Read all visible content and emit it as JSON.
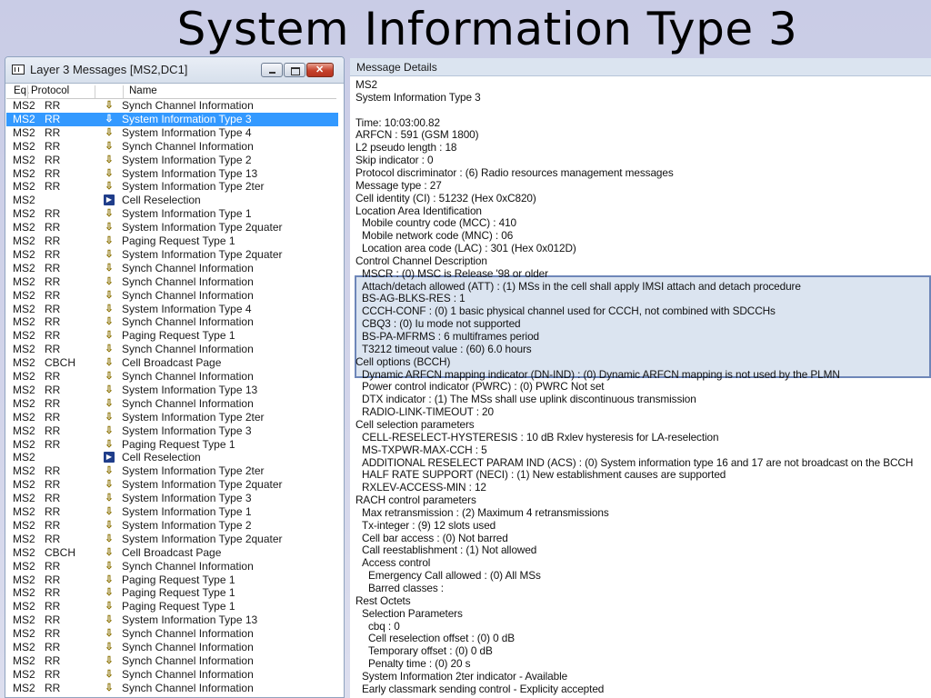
{
  "slide": {
    "title": "System Information Type 3"
  },
  "left_window": {
    "title": "Layer 3 Messages  [MS2,DC1]",
    "columns": {
      "eq": "Eq.",
      "protocol": "Protocol",
      "name": "Name"
    },
    "selected_index": 1,
    "rows": [
      {
        "eq": "MS2",
        "protocol": "RR",
        "icon": "down-arrow-icon",
        "name": "Synch Channel Information"
      },
      {
        "eq": "MS2",
        "protocol": "RR",
        "icon": "down-arrow-icon",
        "name": "System Information Type 3"
      },
      {
        "eq": "MS2",
        "protocol": "RR",
        "icon": "down-arrow-icon",
        "name": "System Information Type 4"
      },
      {
        "eq": "MS2",
        "protocol": "RR",
        "icon": "down-arrow-icon",
        "name": "Synch Channel Information"
      },
      {
        "eq": "MS2",
        "protocol": "RR",
        "icon": "down-arrow-icon",
        "name": "System Information Type 2"
      },
      {
        "eq": "MS2",
        "protocol": "RR",
        "icon": "down-arrow-icon",
        "name": "System Information Type 13"
      },
      {
        "eq": "MS2",
        "protocol": "RR",
        "icon": "down-arrow-icon",
        "name": "System Information Type 2ter"
      },
      {
        "eq": "MS2",
        "protocol": "",
        "icon": "play-icon",
        "name": "Cell Reselection"
      },
      {
        "eq": "MS2",
        "protocol": "RR",
        "icon": "down-arrow-icon",
        "name": "System Information Type 1"
      },
      {
        "eq": "MS2",
        "protocol": "RR",
        "icon": "down-arrow-icon",
        "name": "System Information Type 2quater"
      },
      {
        "eq": "MS2",
        "protocol": "RR",
        "icon": "down-arrow-icon",
        "name": "Paging Request Type 1"
      },
      {
        "eq": "MS2",
        "protocol": "RR",
        "icon": "down-arrow-icon",
        "name": "System Information Type 2quater"
      },
      {
        "eq": "MS2",
        "protocol": "RR",
        "icon": "down-arrow-icon",
        "name": "Synch Channel Information"
      },
      {
        "eq": "MS2",
        "protocol": "RR",
        "icon": "down-arrow-icon",
        "name": "Synch Channel Information"
      },
      {
        "eq": "MS2",
        "protocol": "RR",
        "icon": "down-arrow-icon",
        "name": "Synch Channel Information"
      },
      {
        "eq": "MS2",
        "protocol": "RR",
        "icon": "down-arrow-icon",
        "name": "System Information Type 4"
      },
      {
        "eq": "MS2",
        "protocol": "RR",
        "icon": "down-arrow-icon",
        "name": "Synch Channel Information"
      },
      {
        "eq": "MS2",
        "protocol": "RR",
        "icon": "down-arrow-icon",
        "name": "Paging Request Type 1"
      },
      {
        "eq": "MS2",
        "protocol": "RR",
        "icon": "down-arrow-icon",
        "name": "Synch Channel Information"
      },
      {
        "eq": "MS2",
        "protocol": "CBCH",
        "icon": "down-arrow-icon",
        "name": "Cell Broadcast Page"
      },
      {
        "eq": "MS2",
        "protocol": "RR",
        "icon": "down-arrow-icon",
        "name": "Synch Channel Information"
      },
      {
        "eq": "MS2",
        "protocol": "RR",
        "icon": "down-arrow-icon",
        "name": "System Information Type 13"
      },
      {
        "eq": "MS2",
        "protocol": "RR",
        "icon": "down-arrow-icon",
        "name": "Synch Channel Information"
      },
      {
        "eq": "MS2",
        "protocol": "RR",
        "icon": "down-arrow-icon",
        "name": "System Information Type 2ter"
      },
      {
        "eq": "MS2",
        "protocol": "RR",
        "icon": "down-arrow-icon",
        "name": "System Information Type 3"
      },
      {
        "eq": "MS2",
        "protocol": "RR",
        "icon": "down-arrow-icon",
        "name": "Paging Request Type 1"
      },
      {
        "eq": "MS2",
        "protocol": "",
        "icon": "play-icon",
        "name": "Cell Reselection"
      },
      {
        "eq": "MS2",
        "protocol": "RR",
        "icon": "down-arrow-icon",
        "name": "System Information Type 2ter"
      },
      {
        "eq": "MS2",
        "protocol": "RR",
        "icon": "down-arrow-icon",
        "name": "System Information Type 2quater"
      },
      {
        "eq": "MS2",
        "protocol": "RR",
        "icon": "down-arrow-icon",
        "name": "System Information Type 3"
      },
      {
        "eq": "MS2",
        "protocol": "RR",
        "icon": "down-arrow-icon",
        "name": "System Information Type 1"
      },
      {
        "eq": "MS2",
        "protocol": "RR",
        "icon": "down-arrow-icon",
        "name": "System Information Type 2"
      },
      {
        "eq": "MS2",
        "protocol": "RR",
        "icon": "down-arrow-icon",
        "name": "System Information Type 2quater"
      },
      {
        "eq": "MS2",
        "protocol": "CBCH",
        "icon": "down-arrow-icon",
        "name": "Cell Broadcast Page"
      },
      {
        "eq": "MS2",
        "protocol": "RR",
        "icon": "down-arrow-icon",
        "name": "Synch Channel Information"
      },
      {
        "eq": "MS2",
        "protocol": "RR",
        "icon": "down-arrow-icon",
        "name": "Paging Request Type 1"
      },
      {
        "eq": "MS2",
        "protocol": "RR",
        "icon": "down-arrow-icon",
        "name": "Paging Request Type 1"
      },
      {
        "eq": "MS2",
        "protocol": "RR",
        "icon": "down-arrow-icon",
        "name": "Paging Request Type 1"
      },
      {
        "eq": "MS2",
        "protocol": "RR",
        "icon": "down-arrow-icon",
        "name": "System Information Type 13"
      },
      {
        "eq": "MS2",
        "protocol": "RR",
        "icon": "down-arrow-icon",
        "name": "Synch Channel Information"
      },
      {
        "eq": "MS2",
        "protocol": "RR",
        "icon": "down-arrow-icon",
        "name": "Synch Channel Information"
      },
      {
        "eq": "MS2",
        "protocol": "RR",
        "icon": "down-arrow-icon",
        "name": "Synch Channel Information"
      },
      {
        "eq": "MS2",
        "protocol": "RR",
        "icon": "down-arrow-icon",
        "name": "Synch Channel Information"
      },
      {
        "eq": "MS2",
        "protocol": "RR",
        "icon": "down-arrow-icon",
        "name": "Synch Channel Information"
      }
    ]
  },
  "details": {
    "title": "Message Details",
    "lines": [
      {
        "t": "MS2",
        "i": 0
      },
      {
        "t": "System Information Type 3",
        "i": 0
      },
      {
        "t": "",
        "i": 0
      },
      {
        "t": "Time: 10:03:00.82",
        "i": 0
      },
      {
        "t": "ARFCN : 591 (GSM 1800)",
        "i": 0
      },
      {
        "t": "L2 pseudo length : 18",
        "i": 0
      },
      {
        "t": "Skip indicator : 0",
        "i": 0
      },
      {
        "t": "Protocol discriminator : (6) Radio resources management messages",
        "i": 0
      },
      {
        "t": "Message type : 27",
        "i": 0
      },
      {
        "t": "Cell identity (CI) : 51232 (Hex 0xC820)",
        "i": 0
      },
      {
        "t": "Location Area Identification",
        "i": 0
      },
      {
        "t": "Mobile country code (MCC) : 410",
        "i": 1
      },
      {
        "t": "Mobile network code (MNC) : 06",
        "i": 1
      },
      {
        "t": "Location area code (LAC) : 301 (Hex 0x012D)",
        "i": 1
      },
      {
        "t": "Control Channel Description",
        "i": 0
      },
      {
        "t": "MSCR : (0) MSC is Release '98 or older",
        "i": 1
      },
      {
        "t": "Attach/detach allowed (ATT) : (1) MSs in the cell shall apply IMSI attach and detach procedure",
        "i": 1
      },
      {
        "t": "BS-AG-BLKS-RES : 1",
        "i": 1
      },
      {
        "t": "CCCH-CONF : (0) 1 basic physical channel used for CCCH, not combined with SDCCHs",
        "i": 1
      },
      {
        "t": "CBQ3 : (0) Iu mode not supported",
        "i": 1
      },
      {
        "t": "BS-PA-MFRMS : 6 multiframes period",
        "i": 1
      },
      {
        "t": "T3212 timeout value : (60) 6.0 hours",
        "i": 1
      },
      {
        "t": "Cell options (BCCH)",
        "i": 0
      },
      {
        "t": "Dynamic ARFCN mapping indicator (DN-IND) : (0) Dynamic ARFCN mapping is not used by the PLMN",
        "i": 1
      },
      {
        "t": "Power control indicator (PWRC) : (0) PWRC Not set",
        "i": 1
      },
      {
        "t": "DTX indicator : (1) The MSs shall use uplink discontinuous transmission",
        "i": 1
      },
      {
        "t": "RADIO-LINK-TIMEOUT : 20",
        "i": 1
      },
      {
        "t": "Cell selection parameters",
        "i": 0
      },
      {
        "t": "CELL-RESELECT-HYSTERESIS : 10 dB Rxlev hysteresis for LA-reselection",
        "i": 1
      },
      {
        "t": "MS-TXPWR-MAX-CCH : 5",
        "i": 1
      },
      {
        "t": "ADDITIONAL RESELECT PARAM IND (ACS) : (0) System information type 16 and 17 are not broadcast on the BCCH",
        "i": 1
      },
      {
        "t": "HALF RATE SUPPORT (NECI) : (1) New establishment causes are supported",
        "i": 1
      },
      {
        "t": "RXLEV-ACCESS-MIN : 12",
        "i": 1
      },
      {
        "t": "RACH control parameters",
        "i": 0
      },
      {
        "t": "Max retransmission : (2) Maximum 4 retransmissions",
        "i": 1
      },
      {
        "t": "Tx-integer : (9) 12 slots used",
        "i": 1
      },
      {
        "t": "Cell bar access : (0) Not barred",
        "i": 1
      },
      {
        "t": "Call reestablishment : (1) Not allowed",
        "i": 1
      },
      {
        "t": "Access control",
        "i": 1
      },
      {
        "t": "Emergency Call allowed : (0) All MSs",
        "i": 2
      },
      {
        "t": "Barred classes :",
        "i": 2
      },
      {
        "t": "Rest Octets",
        "i": 0
      },
      {
        "t": "Selection Parameters",
        "i": 1
      },
      {
        "t": "cbq : 0",
        "i": 2
      },
      {
        "t": "Cell reselection offset : (0) 0 dB",
        "i": 2
      },
      {
        "t": "Temporary offset : (0) 0 dB",
        "i": 2
      },
      {
        "t": "Penalty time : (0) 20 s",
        "i": 2
      },
      {
        "t": "System Information 2ter indicator - Available",
        "i": 1
      },
      {
        "t": "Early classmark sending control - Explicity accepted",
        "i": 1
      }
    ]
  },
  "colors": {
    "selection": "#3399ff",
    "highlight_border": "#6e86b8",
    "highlight_fill": "#dbe4f0"
  }
}
